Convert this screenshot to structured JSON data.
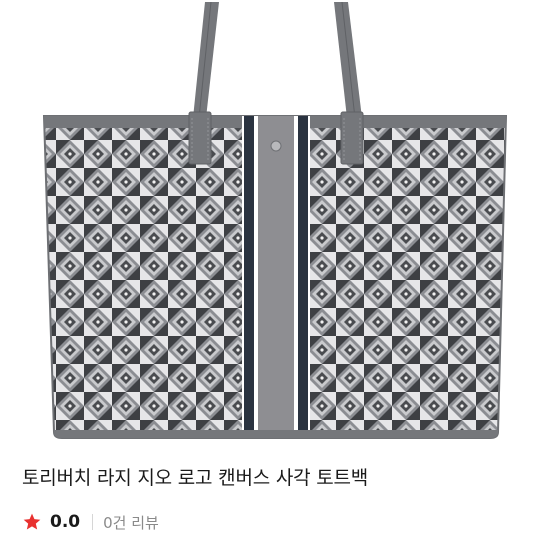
{
  "product": {
    "title": "토리버치 라지 지오 로고 캔버스 사각 토트백",
    "image_icon": "tote-bag-image",
    "rating": "0.0",
    "reviews": "0건 리뷰"
  },
  "colors": {
    "star": "#e8312f",
    "title": "#1a1a1a",
    "review_text": "#8a8a8a",
    "bag_dark": "#3e4044",
    "bag_mid": "#8b8d92",
    "bag_light": "#e6e6e8",
    "stripe_navy": "#2a3340",
    "stripe_grey": "#8e8e92",
    "trim": "#75777b"
  }
}
